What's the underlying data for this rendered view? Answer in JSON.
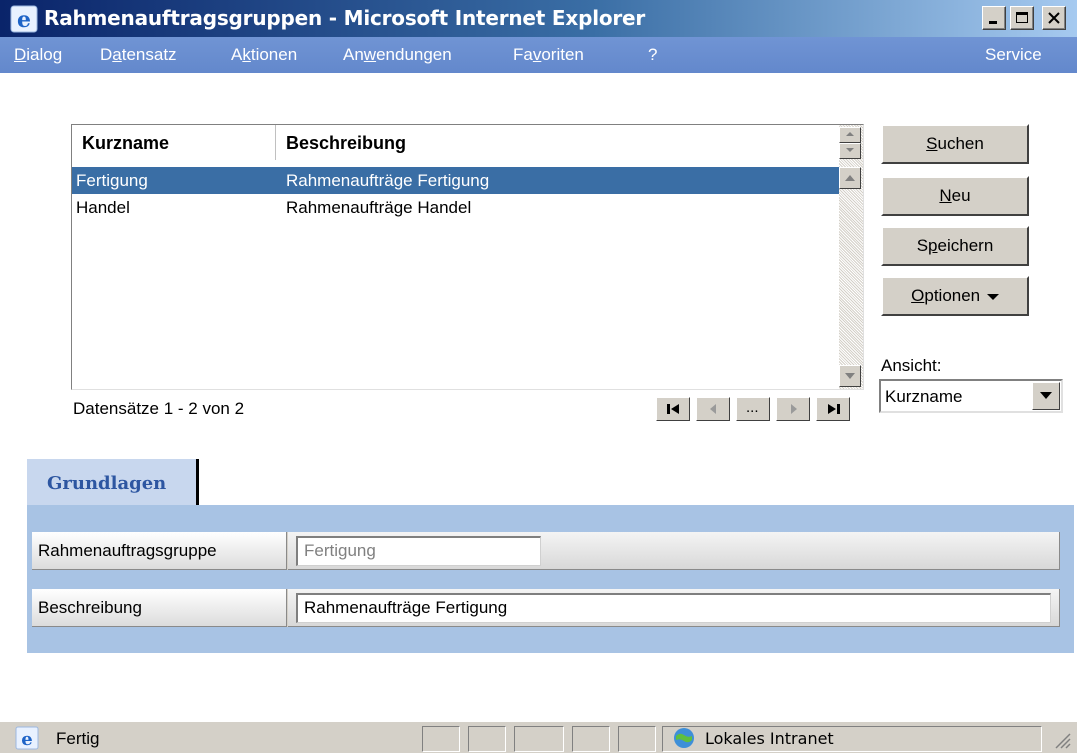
{
  "window": {
    "title": "Rahmenauftragsgruppen - Microsoft Internet Explorer"
  },
  "menu": {
    "items": [
      {
        "pre": "",
        "u": "D",
        "post": "ialog"
      },
      {
        "pre": "D",
        "u": "a",
        "post": "tensatz"
      },
      {
        "pre": "A",
        "u": "k",
        "post": "tionen"
      },
      {
        "pre": "An",
        "u": "w",
        "post": "endungen"
      },
      {
        "pre": "Fa",
        "u": "v",
        "post": "oriten"
      },
      {
        "pre": "?",
        "u": "",
        "post": ""
      }
    ],
    "service": "Service"
  },
  "list": {
    "columns": [
      "Kurzname",
      "Beschreibung"
    ],
    "rows": [
      {
        "kurzname": "Fertigung",
        "beschreibung": "Rahmenaufträge Fertigung",
        "selected": true
      },
      {
        "kurzname": "Handel",
        "beschreibung": "Rahmenaufträge Handel",
        "selected": false
      }
    ],
    "records_text": "Datensätze 1 - 2 von 2",
    "nav_more": "..."
  },
  "buttons": {
    "suchen": {
      "u": "S",
      "post": "uchen"
    },
    "neu": {
      "u": "N",
      "post": "eu"
    },
    "speichern": {
      "pre": "S",
      "u": "p",
      "post": "eichern"
    },
    "optionen": {
      "u": "O",
      "post": "ptionen"
    }
  },
  "view": {
    "label": "Ansicht:",
    "selected": "Kurzname"
  },
  "tabs": {
    "active": "Grundlagen"
  },
  "form": {
    "group_label": "Rahmenauftragsgruppe",
    "group_value": "Fertigung",
    "desc_label": "Beschreibung",
    "desc_value": "Rahmenaufträge Fertigung"
  },
  "status": {
    "text": "Fertig",
    "zone": "Lokales Intranet"
  },
  "colors": {
    "title_gradient_start": "#0a246a",
    "menubar": "#6b8fd1",
    "selection": "#3a6ea5",
    "tab_text": "#2d56a1",
    "panel": "#a8c3e4"
  }
}
